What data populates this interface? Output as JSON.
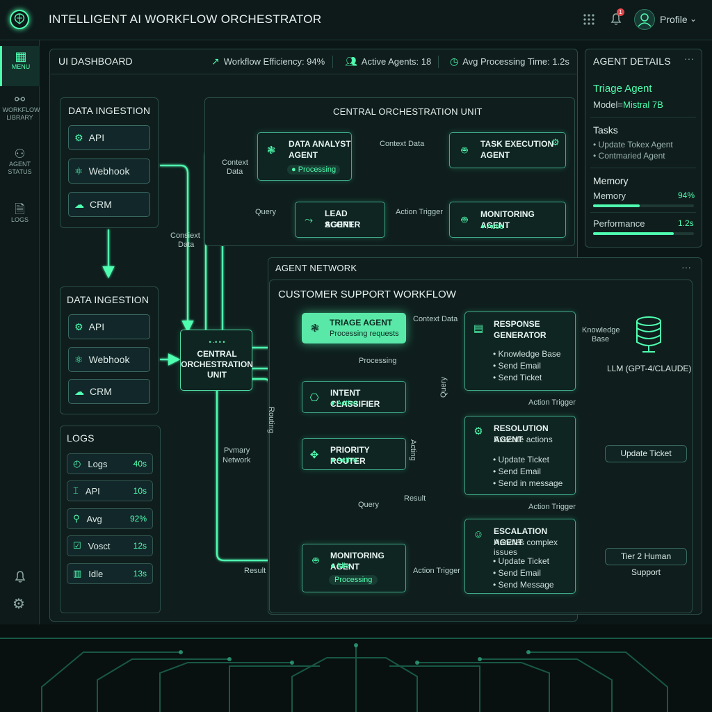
{
  "app": {
    "title": "INTELLIGENT AI WORKFLOW ORCHESTRATOR",
    "profile": "Profile",
    "notification_count": "1"
  },
  "sidebar": {
    "items": [
      {
        "label": "MENU",
        "icon": "grid-icon"
      },
      {
        "label": "WORKFLOW LIBRARY",
        "icon": "workflow-icon"
      },
      {
        "label": "AGENT STATUS",
        "icon": "network-icon"
      },
      {
        "label": "LOGS",
        "icon": "document-icon"
      }
    ]
  },
  "dashboard": {
    "title": "UI DASHBOARD",
    "metrics": [
      {
        "label": "Workflow Efficiency: 94%"
      },
      {
        "label": "Active Agents: 18"
      },
      {
        "label": "Avg Processing Time: 1.2s"
      }
    ]
  },
  "ingestion_top": {
    "title": "DATA INGESTION",
    "items": [
      "API",
      "Webhook",
      "CRM"
    ]
  },
  "ingestion_mid": {
    "title": "DATA INGESTION",
    "items": [
      "API",
      "Webhook",
      "CRM"
    ]
  },
  "logs": {
    "title": "LOGS",
    "items": [
      {
        "label": "Logs",
        "value": "40s"
      },
      {
        "label": "API",
        "value": "10s"
      },
      {
        "label": "Avg",
        "value": "92%"
      },
      {
        "label": "Vosct",
        "value": "12s"
      },
      {
        "label": "Idle",
        "value": "13s"
      }
    ]
  },
  "central_unit": {
    "title": "CENTRAL ORCHESTRATION UNIT",
    "data_analyst": {
      "name1": "DATA ANALYST",
      "name2": "AGENT",
      "status": "Processing"
    },
    "task_execution": {
      "name1": "TASK EXECUTION",
      "name2": "AGENT"
    },
    "lead_scorer": {
      "name1": "LEAD SCORER",
      "name2": "AGENT"
    },
    "monitoring": {
      "name": "MONITORING AGENT",
      "status": "Actie"
    },
    "edge_context": "Context Data",
    "edge_query": "Query",
    "edge_action": "Action Trigger",
    "edge_context_left1": "Context",
    "edge_context_left2": "Data"
  },
  "left_edge": {
    "consext1": "Consiext",
    "consext2": "Data"
  },
  "hub": {
    "dots": "• ·• • •",
    "line1": "CENTRAL",
    "line2": "ORCHESTRATION",
    "line3": "UNIT"
  },
  "agent_details": {
    "title": "AGENT DETAILS",
    "agent_name": "Triage Agent",
    "model_label": "Model=",
    "model_value": "Mistral 7B",
    "tasks_title": "Tasks",
    "tasks": [
      "• Update Tokex Agent",
      "• Contmaried Agent"
    ],
    "memory_title": "Memory",
    "memory_label": "Memory",
    "memory_value": "94%",
    "memory_fill": 0.46,
    "performance_label": "Performance",
    "performance_value": "1.2s",
    "performance_fill": 0.8
  },
  "network": {
    "title": "AGENT NETWORK",
    "workflow_title": "CUSTOMER SUPPORT WORKFLOW",
    "triage": {
      "name": "TRIAGE AGENT",
      "status": "Processing requests"
    },
    "intent": {
      "name": "INTENT CLASSIFIER",
      "status": "Active"
    },
    "priority": {
      "name": "PRIORITY ROUTER",
      "status": "Active"
    },
    "monitor": {
      "name": "MONITORING AGENT",
      "status": "Idle",
      "badge": "Processing"
    },
    "response": {
      "name1": "RESPONSE",
      "name2": "GENERATOR",
      "bullets": [
        "• Knowledge Base",
        "• Send Email",
        "• Send Ticket"
      ]
    },
    "resolution": {
      "name": "RESOLUTION AGENT",
      "sub": "Execute actions",
      "bullets": [
        "• Update Ticket",
        "• Send Email",
        "• Send in message"
      ]
    },
    "escalation": {
      "name": "ESCALATION AGENT",
      "sub": "Handles complex issues",
      "bullets": [
        "• Update Ticket",
        "• Send Email",
        "• Send Message"
      ]
    },
    "kb_label1": "Knowledge",
    "kb_label2": "Base",
    "llm": "LLM (GPT-4/CLAUDE)",
    "update_ticket": "Update Ticket",
    "tier2": "Tier 2 Human Support",
    "edges": {
      "context_data": "Context Data",
      "processing": "Processing",
      "query_v": "Query",
      "acting_v": "Acting",
      "query": "Query",
      "result": "Result",
      "action_trigger1": "Action Trigger",
      "action_trigger2": "Action Trigger",
      "action_trigger3": "Action Trigger",
      "result_left": "Result",
      "primary1": "Pvmary",
      "primary2": "Network",
      "routing_v": "Routing"
    }
  },
  "colors": {
    "accent": "#4fffb0",
    "bg": "#0b1716",
    "panel": "#0f1e1d",
    "border": "#2b4d47"
  }
}
